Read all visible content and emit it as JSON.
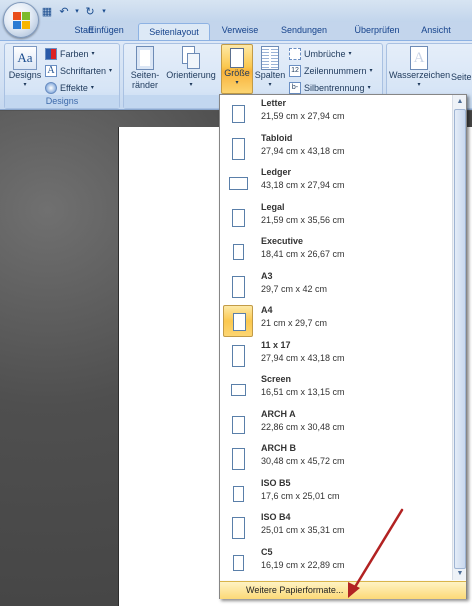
{
  "tabs": [
    "Start",
    "Einfügen",
    "Seitenlayout",
    "Verweise",
    "Sendungen",
    "Überprüfen",
    "Ansicht"
  ],
  "active_tab": "Seitenlayout",
  "ribbon": {
    "designs_group": {
      "designs_label": "Designs",
      "farben": "Farben",
      "schriftarten": "Schriftarten",
      "effekte": "Effekte",
      "group_label": "Designs"
    },
    "page_setup_group": {
      "seitenraender_line1": "Seiten-",
      "seitenraender_line2": "ränder",
      "orientierung": "Orientierung",
      "groesse": "Größe",
      "spalten": "Spalten",
      "umbrueche": "Umbrüche",
      "zeilennummern": "Zeilennummern",
      "silbentrennung": "Silbentrennung",
      "group_label_partial": "S"
    },
    "background_group": {
      "wasserzeichen": "Wasserzeichen",
      "seite_partial": "Seite"
    }
  },
  "paper_sizes": [
    {
      "name": "Letter",
      "dims": "21,59 cm x 27,94 cm",
      "shape": "portrait",
      "selected": false
    },
    {
      "name": "Tabloid",
      "dims": "27,94 cm x 43,18 cm",
      "shape": "portrait-tall",
      "selected": false
    },
    {
      "name": "Ledger",
      "dims": "43,18 cm x 27,94 cm",
      "shape": "landscape",
      "selected": false
    },
    {
      "name": "Legal",
      "dims": "21,59 cm x 35,56 cm",
      "shape": "portrait",
      "selected": false
    },
    {
      "name": "Executive",
      "dims": "18,41 cm x 26,67 cm",
      "shape": "portrait-small",
      "selected": false
    },
    {
      "name": "A3",
      "dims": "29,7 cm x 42 cm",
      "shape": "portrait-tall",
      "selected": false
    },
    {
      "name": "A4",
      "dims": "21 cm x 29,7 cm",
      "shape": "portrait",
      "selected": true
    },
    {
      "name": "11 x 17",
      "dims": "27,94 cm x 43,18 cm",
      "shape": "portrait-tall",
      "selected": false
    },
    {
      "name": "Screen",
      "dims": "16,51 cm x 13,15 cm",
      "shape": "landscape-small",
      "selected": false
    },
    {
      "name": "ARCH A",
      "dims": "22,86 cm x 30,48 cm",
      "shape": "portrait",
      "selected": false
    },
    {
      "name": "ARCH B",
      "dims": "30,48 cm x 45,72 cm",
      "shape": "portrait-tall",
      "selected": false
    },
    {
      "name": "ISO B5",
      "dims": "17,6 cm x 25,01 cm",
      "shape": "portrait-small",
      "selected": false
    },
    {
      "name": "ISO B4",
      "dims": "25,01 cm x 35,31 cm",
      "shape": "portrait-tall",
      "selected": false
    },
    {
      "name": "C5",
      "dims": "16,19 cm x 22,89 cm",
      "shape": "portrait-small",
      "selected": false
    }
  ],
  "more_formats_label": "Weitere Papierformate...",
  "colors": {
    "accent": "#fbc84f",
    "arrow": "#b22222",
    "ribbon": "#d1e0f3"
  }
}
